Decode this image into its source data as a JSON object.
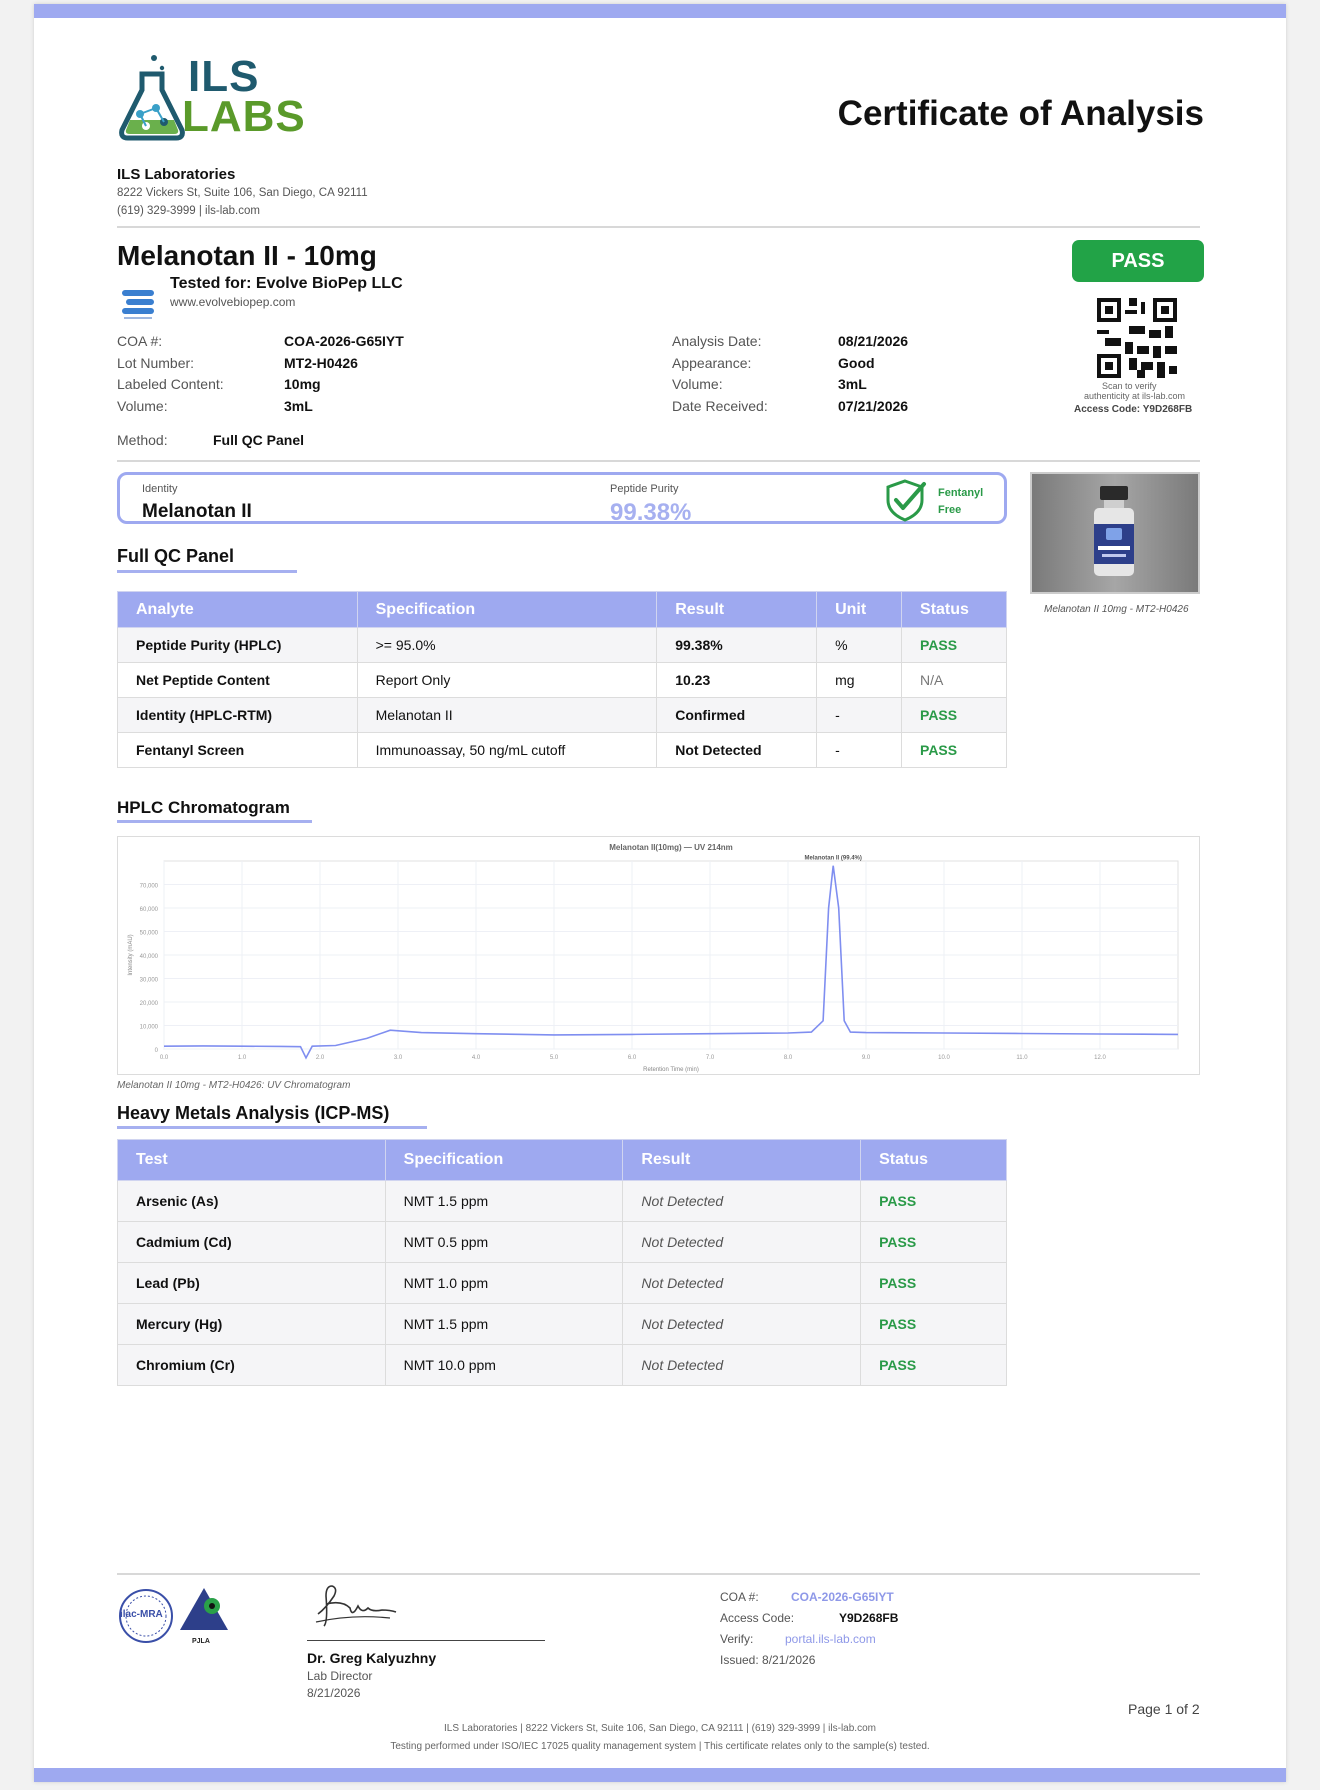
{
  "header": {
    "logo_top": "ILS",
    "logo_bottom": "LABS",
    "title": "Certificate of Analysis"
  },
  "lab": {
    "name": "ILS Laboratories",
    "address": "8222 Vickers St, Suite 106, San Diego, CA 92111",
    "contact": "(619) 329-3999  |  ils-lab.com"
  },
  "product": {
    "name": "Melanotan II - 10mg",
    "tested_for": "Tested for: Evolve BioPep LLC",
    "client_website": "www.evolvebiopep.com",
    "status": "PASS"
  },
  "qr": {
    "caption_1": "Scan to verify",
    "caption_2": "authenticity at ils-lab.com",
    "access_code": "Access Code: Y9D268FB"
  },
  "meta_left": [
    {
      "label": "COA #:",
      "value": "COA-2026-G65IYT"
    },
    {
      "label": "Lot Number:",
      "value": "MT2-H0426"
    },
    {
      "label": "Labeled Content:",
      "value": "10mg"
    },
    {
      "label": "Volume:",
      "value": "3mL"
    }
  ],
  "meta_right": [
    {
      "label": "Analysis Date:",
      "value": "08/21/2026"
    },
    {
      "label": "Appearance:",
      "value": "Good"
    },
    {
      "label": "Volume:",
      "value": "3mL"
    },
    {
      "label": "Date Received:",
      "value": "07/21/2026"
    }
  ],
  "method": {
    "label": "Method:",
    "value": "Full QC Panel"
  },
  "summary": {
    "identity_label": "Identity",
    "identity_value": "Melanotan II",
    "purity_label": "Peptide Purity",
    "purity_value": "99.38%",
    "fentanyl_badge": "Fentanyl Free"
  },
  "photo": {
    "caption": "Melanotan II 10mg - MT2-H0426"
  },
  "qc_panel": {
    "title": "Full QC Panel",
    "headers": [
      "Analyte",
      "Specification",
      "Result",
      "Unit",
      "Status"
    ],
    "rows": [
      [
        "Peptide Purity (HPLC)",
        ">= 95.0%",
        "99.38%",
        "%",
        "PASS"
      ],
      [
        "Net Peptide Content",
        "Report Only",
        "10.23",
        "mg",
        "N/A"
      ],
      [
        "Identity (HPLC-RTM)",
        "Melanotan II",
        "Confirmed",
        "-",
        "PASS"
      ],
      [
        "Fentanyl Screen",
        "Immunoassay, 50 ng/mL cutoff",
        "Not Detected",
        "-",
        "PASS"
      ]
    ]
  },
  "chromatogram": {
    "title": "HPLC Chromatogram",
    "caption": "Melanotan II 10mg - MT2-H0426: UV Chromatogram"
  },
  "chart_data": {
    "type": "line",
    "title": "Melanotan II(10mg) — UV 214nm",
    "xlabel": "Retention Time (min)",
    "ylabel": "Intensity (mAU)",
    "peak_label": "Melanotan II (99.4%)",
    "xlim": [
      0,
      13
    ],
    "ylim": [
      0,
      80000
    ],
    "x_ticks": [
      0,
      1,
      2,
      3,
      4,
      5,
      6,
      7,
      8,
      9,
      10,
      11,
      12
    ],
    "y_ticks": [
      0,
      10000,
      20000,
      30000,
      40000,
      50000,
      60000,
      70000
    ],
    "series": [
      {
        "x": [
          0,
          0.5,
          1.0,
          1.5,
          1.75,
          1.82,
          1.9,
          2.2,
          2.6,
          2.9,
          3.3,
          4,
          5,
          6,
          7,
          8,
          8.3,
          8.45,
          8.52,
          8.58,
          8.65,
          8.72,
          8.8,
          9,
          10,
          11,
          12,
          13
        ],
        "y": [
          1200,
          1300,
          1200,
          1100,
          1000,
          -3800,
          1200,
          1500,
          4500,
          8000,
          7000,
          6500,
          6000,
          6200,
          6500,
          6800,
          7200,
          12000,
          60000,
          78000,
          60000,
          12000,
          7200,
          7000,
          6800,
          6600,
          6400,
          6200
        ]
      }
    ],
    "grid": true
  },
  "heavy_metals": {
    "title": "Heavy Metals Analysis (ICP-MS)",
    "headers": [
      "Test",
      "Specification",
      "Result",
      "Status"
    ],
    "rows": [
      [
        "Arsenic (As)",
        "NMT 1.5 ppm",
        "Not Detected",
        "PASS"
      ],
      [
        "Cadmium (Cd)",
        "NMT 0.5 ppm",
        "Not Detected",
        "PASS"
      ],
      [
        "Lead (Pb)",
        "NMT 1.0 ppm",
        "Not Detected",
        "PASS"
      ],
      [
        "Mercury (Hg)",
        "NMT 1.5 ppm",
        "Not Detected",
        "PASS"
      ],
      [
        "Chromium (Cr)",
        "NMT 10.0 ppm",
        "Not Detected",
        "PASS"
      ]
    ]
  },
  "footer": {
    "accred_1": "ilac-MRA",
    "accred_2": "PJLA",
    "signer_name": "Dr. Greg Kalyuzhny",
    "signer_role": "Lab Director",
    "signer_date": "8/21/2026",
    "coa_label": "COA #:",
    "coa_value": "COA-2026-G65IYT",
    "access_label": "Access Code:",
    "access_value": "Y9D268FB",
    "verify_label": "Verify:",
    "verify_value": "portal.ils-lab.com",
    "issued": "Issued: 8/21/2026",
    "page": "Page 1 of 2",
    "line1": "ILS Laboratories  |  8222 Vickers St, Suite 106, San Diego, CA 92111  |  (619) 329-3999  |  ils-lab.com",
    "line2": "Testing performed under ISO/IEC 17025 quality management system  |  This certificate relates only to the sample(s) tested."
  }
}
